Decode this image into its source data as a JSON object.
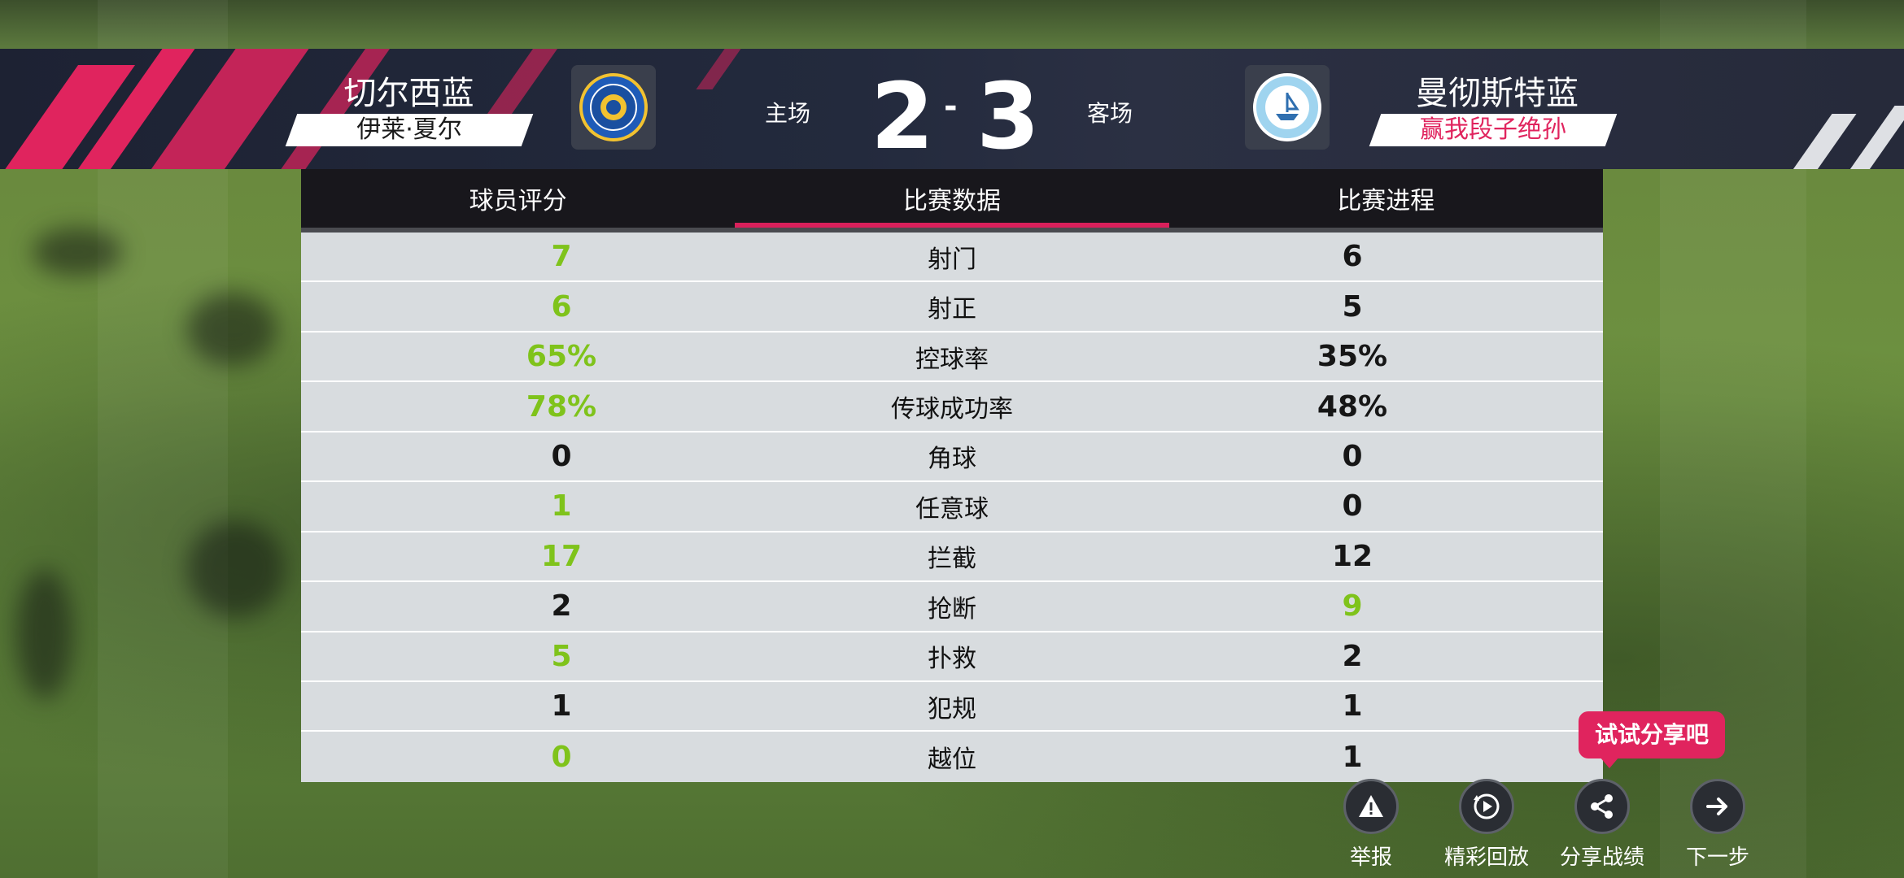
{
  "match": {
    "home_team": "切尔西蓝",
    "home_player": "伊莱·夏尔",
    "home_label": "主场",
    "home_score": "2",
    "separator": "-",
    "away_score": "3",
    "away_label": "客场",
    "away_team": "曼彻斯特蓝",
    "away_player": "赢我段子绝孙"
  },
  "tabs": [
    {
      "label": "球员评分"
    },
    {
      "label": "比赛数据"
    },
    {
      "label": "比赛进程"
    }
  ],
  "active_tab": "比赛数据",
  "stats": [
    {
      "label": "射门",
      "home": "7",
      "away": "6",
      "leader": "home"
    },
    {
      "label": "射正",
      "home": "6",
      "away": "5",
      "leader": "home"
    },
    {
      "label": "控球率",
      "home": "65%",
      "away": "35%",
      "leader": "home"
    },
    {
      "label": "传球成功率",
      "home": "78%",
      "away": "48%",
      "leader": "home"
    },
    {
      "label": "角球",
      "home": "0",
      "away": "0",
      "leader": "none"
    },
    {
      "label": "任意球",
      "home": "1",
      "away": "0",
      "leader": "home"
    },
    {
      "label": "拦截",
      "home": "17",
      "away": "12",
      "leader": "home"
    },
    {
      "label": "抢断",
      "home": "2",
      "away": "9",
      "leader": "away"
    },
    {
      "label": "扑救",
      "home": "5",
      "away": "2",
      "leader": "home"
    },
    {
      "label": "犯规",
      "home": "1",
      "away": "1",
      "leader": "none"
    },
    {
      "label": "越位",
      "home": "0",
      "away": "1",
      "leader": "home"
    }
  ],
  "actions": {
    "report": "举报",
    "replay": "精彩回放",
    "share": "分享战绩",
    "next": "下一步"
  },
  "share_tip": "试试分享吧",
  "colors": {
    "accent": "#e0245e",
    "leader_green": "#7fc31b",
    "header_bg": "#1d2233"
  },
  "icons": {
    "report": "warning-icon",
    "replay": "replay-icon",
    "share": "share-icon",
    "next": "arrow-right-icon",
    "home_crest": "chelsea-crest-icon",
    "away_crest": "manchester-crest-icon"
  }
}
